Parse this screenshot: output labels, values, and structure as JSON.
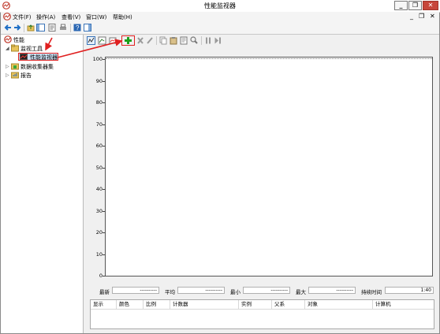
{
  "window": {
    "title": "性能监视器",
    "controls": {
      "minimize": "_",
      "restore": "❐",
      "close": "✕"
    },
    "inner_controls": {
      "minimize": "_",
      "restore": "❐",
      "close": "✕"
    }
  },
  "menu": {
    "items": [
      "文件(F)",
      "操作(A)",
      "查看(V)",
      "窗口(W)",
      "帮助(H)"
    ]
  },
  "tree": {
    "root": "性能",
    "monitor_tools": "监视工具",
    "perfmon": "性能监视器",
    "data_collector_sets": "数据收集器集",
    "reports": "报告"
  },
  "graph": {
    "y_ticks": [
      "100",
      "90",
      "80",
      "70",
      "60",
      "50",
      "40",
      "30",
      "20",
      "10",
      "0"
    ],
    "ylim": [
      0,
      100
    ]
  },
  "stats": {
    "last_label": "最新",
    "last_value": "----------",
    "avg_label": "平均",
    "avg_value": "----------",
    "min_label": "最小",
    "min_value": "----------",
    "max_label": "最大",
    "max_value": "----------",
    "duration_label": "持续时间",
    "duration_value": "1:40"
  },
  "counter_table": {
    "columns": [
      "显示",
      "颜色",
      "比例",
      "计数器",
      "实例",
      "父系",
      "对象",
      "计算机"
    ]
  },
  "colors": {
    "accent_green": "#19a11a",
    "annotation_red": "#e02020",
    "selection": "#cfe3f7"
  }
}
